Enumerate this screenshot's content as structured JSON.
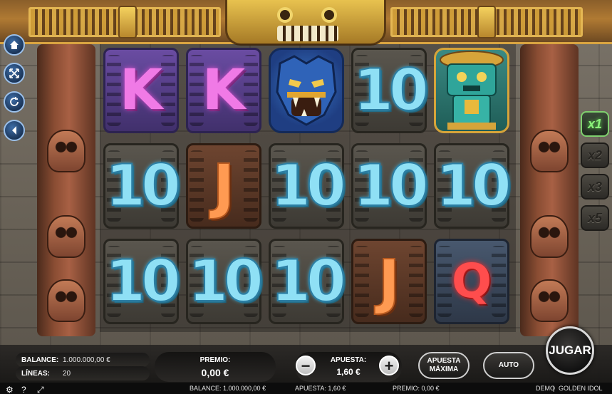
{
  "game": {
    "title": "GOLDEN IDOL",
    "mode": "DEMO"
  },
  "side_buttons": [
    {
      "icon": "home-icon"
    },
    {
      "icon": "fullscreen-icon"
    },
    {
      "icon": "refresh-icon"
    },
    {
      "icon": "sound-icon"
    }
  ],
  "multipliers": [
    "x1",
    "x2",
    "x3",
    "x5"
  ],
  "active_multiplier": "x1",
  "reels": [
    [
      "K",
      "10",
      "10"
    ],
    [
      "K",
      "J",
      "10"
    ],
    [
      "jaguar",
      "10",
      "10"
    ],
    [
      "10",
      "10",
      "J"
    ],
    [
      "idol",
      "10",
      "Q"
    ]
  ],
  "panel": {
    "balance_label": "BALANCE:",
    "balance_value": "1.000.000,00 €",
    "lines_label": "LÍNEAS:",
    "lines_value": "20",
    "premio_label": "PREMIO:",
    "premio_value": "0,00 €",
    "bet_label": "APUESTA:",
    "bet_value": "1,60 €",
    "minus": "−",
    "plus": "+",
    "max_bet": "APUESTA MÁXIMA",
    "auto": "AUTO",
    "spin": "JUGAR"
  },
  "status_bar": {
    "balance": "BALANCE:  1.000.000,00 €",
    "bet": "APUESTA:  1,60 €",
    "premio": "PREMIO:  0,00 €",
    "mode": "DEMO",
    "separator": "|",
    "title": "GOLDEN IDOL",
    "help": "?",
    "settings_icon": "gear-icon",
    "expand_icon": "expand-icon"
  },
  "colors": {
    "accent_gold": "#d9a441",
    "multiplier_active": "#8bf27a",
    "ten_cyan": "#8fe0f5",
    "k_pink": "#f07ae6",
    "j_orange": "#ff9a52",
    "q_red": "#ff4d4d"
  }
}
